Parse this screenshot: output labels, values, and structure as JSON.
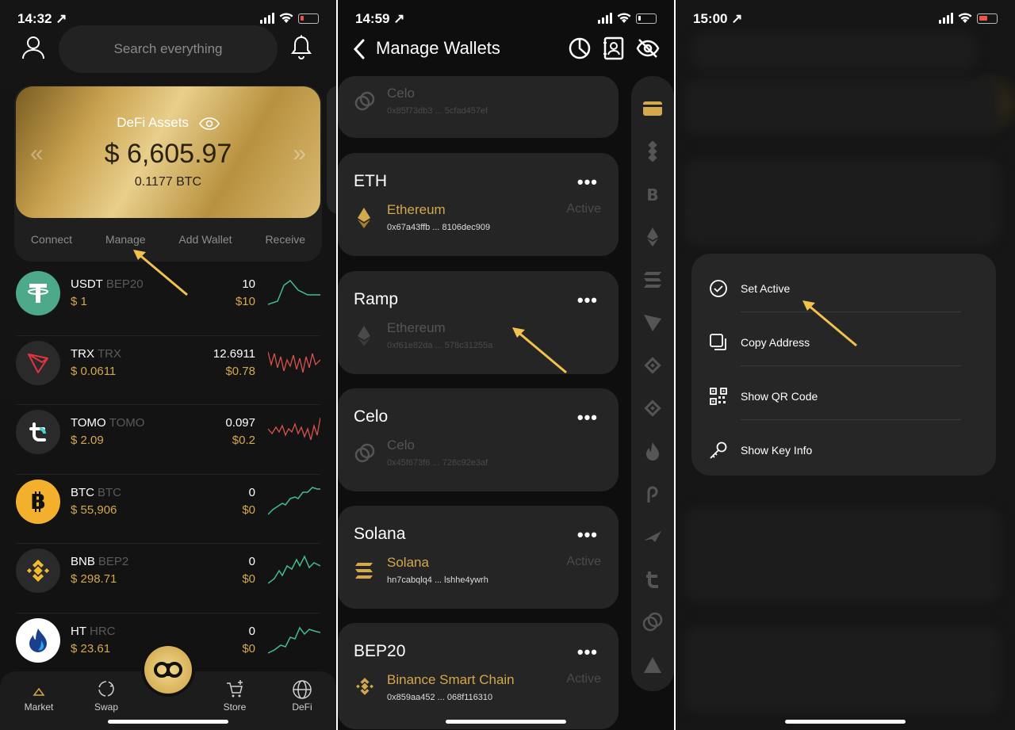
{
  "screen1": {
    "status": {
      "time": "14:32 ↗"
    },
    "search": {
      "placeholder": "Search everything"
    },
    "card": {
      "label": "DeFi Assets",
      "amount": "$ 6,605.97",
      "btc": "0.1177 BTC"
    },
    "actions": [
      "Connect",
      "Manage",
      "Add Wallet",
      "Receive"
    ],
    "assets": [
      {
        "symbol": "USDT",
        "network": "BEP20",
        "price": "$ 1",
        "qty": "10",
        "value": "$10",
        "color": "#4ea88a"
      },
      {
        "symbol": "TRX",
        "network": "TRX",
        "price": "$ 0.0611",
        "qty": "12.6911",
        "value": "$0.78",
        "color": "#2a2a2a"
      },
      {
        "symbol": "TOMO",
        "network": "TOMO",
        "price": "$ 2.09",
        "qty": "0.097",
        "value": "$0.2",
        "color": "#2a2a2a"
      },
      {
        "symbol": "BTC",
        "network": "BTC",
        "price": "$ 55,906",
        "qty": "0",
        "value": "$0",
        "color": "#f3b02c"
      },
      {
        "symbol": "BNB",
        "network": "BEP2",
        "price": "$ 298.71",
        "qty": "0",
        "value": "$0",
        "color": "#2a2a2a"
      },
      {
        "symbol": "HT",
        "network": "HRC",
        "price": "$ 23.61",
        "qty": "0",
        "value": "$0",
        "color": "#ffffff"
      }
    ],
    "tabs": {
      "market": "Market",
      "swap": "Swap",
      "store": "Store",
      "defi": "DeFi"
    }
  },
  "screen2": {
    "status": {
      "time": "14:59 ↗"
    },
    "title": "Manage Wallets",
    "wallets": [
      {
        "title": "",
        "name": "Celo",
        "address": "0x85f73db3 ... 5cfad457ef",
        "status": "",
        "active": false
      },
      {
        "title": "ETH",
        "name": "Ethereum",
        "address": "0x67a43ffb ... 8106dec909",
        "status": "Active",
        "active": true
      },
      {
        "title": "Ramp",
        "name": "Ethereum",
        "address": "0xf61e82da ... 578c31255a",
        "status": "",
        "active": false
      },
      {
        "title": "Celo",
        "name": "Celo",
        "address": "0x45f673f6 ... 726c92e3af",
        "status": "",
        "active": false
      },
      {
        "title": "Solana",
        "name": "Solana",
        "address": "hn7cabqlq4 ... lshhe4ywrh",
        "status": "Active",
        "active": true
      },
      {
        "title": "BEP20",
        "name": "Binance Smart Chain",
        "address": "0x859aa452 ... 068f116310",
        "status": "Active",
        "active": true
      }
    ]
  },
  "screen3": {
    "status": {
      "time": "15:00 ↗"
    },
    "menu": [
      {
        "label": "Set Active",
        "icon": "check-circle-icon"
      },
      {
        "label": "Copy Address",
        "icon": "copy-icon"
      },
      {
        "label": "Show QR Code",
        "icon": "qr-code-icon"
      },
      {
        "label": "Show Key Info",
        "icon": "key-icon"
      }
    ]
  },
  "colors": {
    "gold": "#d4a84c",
    "annotation_arrow": "#f2c14e",
    "card": "#252525"
  }
}
